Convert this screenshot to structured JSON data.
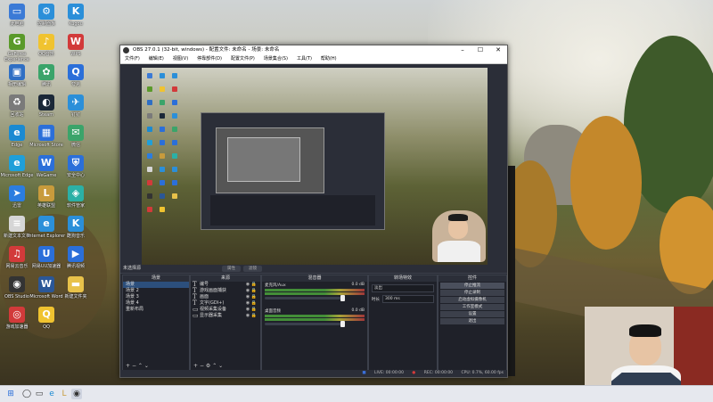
{
  "desktop": {
    "icons": [
      {
        "label": "此电脑",
        "color": "#3b7ad6",
        "glyph": "▭"
      },
      {
        "label": "GeForce Experience",
        "color": "#5a9a2a",
        "glyph": "G"
      },
      {
        "label": "相册编辑",
        "color": "#2f6fc4",
        "glyph": "▣"
      },
      {
        "label": "回收站",
        "color": "#7a7a7a",
        "glyph": "♻"
      },
      {
        "label": "Edge",
        "color": "#1b8ad2",
        "glyph": "e"
      },
      {
        "label": "Microsoft Edge",
        "color": "#1f9fd9",
        "glyph": "e"
      },
      {
        "label": "迅雷",
        "color": "#2b7de0",
        "glyph": "➤"
      },
      {
        "label": "新建文本文档",
        "color": "#d6d6d6",
        "glyph": "≡"
      },
      {
        "label": "网易云音乐",
        "color": "#d23a3a",
        "glyph": "♫"
      },
      {
        "label": "OBS Studio",
        "color": "#333333",
        "glyph": "◉"
      },
      {
        "label": "游戏加速器",
        "color": "#d23a3a",
        "glyph": "◎"
      },
      {
        "label": "控制面板",
        "color": "#2b8fd9",
        "glyph": "⚙"
      },
      {
        "label": "QQ音乐",
        "color": "#f0c330",
        "glyph": "♪"
      },
      {
        "label": "腾讯",
        "color": "#3ba46a",
        "glyph": "✿"
      },
      {
        "label": "Steam",
        "color": "#1b2838",
        "glyph": "◐"
      },
      {
        "label": "Microsoft Store",
        "color": "#2b6fd9",
        "glyph": "▦"
      },
      {
        "label": "WeGame",
        "color": "#2b6fd9",
        "glyph": "W"
      },
      {
        "label": "英雄联盟",
        "color": "#c89b3c",
        "glyph": "L"
      },
      {
        "label": "Internet Explorer",
        "color": "#2b8fd9",
        "glyph": "e"
      },
      {
        "label": "网易UU加速器",
        "color": "#2b6fd9",
        "glyph": "U"
      },
      {
        "label": "Microsoft Word",
        "color": "#2b5797",
        "glyph": "W"
      },
      {
        "label": "QQ",
        "color": "#f0c330",
        "glyph": "Q"
      },
      {
        "label": "Kugou",
        "color": "#2b8fd9",
        "glyph": "K"
      },
      {
        "label": "WPS",
        "color": "#d23a3a",
        "glyph": "W"
      },
      {
        "label": "夸克",
        "color": "#2b6fd9",
        "glyph": "Q"
      },
      {
        "label": "钉钉",
        "color": "#2b8fd9",
        "glyph": "✈"
      },
      {
        "label": "微信",
        "color": "#3ba46a",
        "glyph": "✉"
      },
      {
        "label": "安全中心",
        "color": "#2b6fd9",
        "glyph": "⛨"
      },
      {
        "label": "软件管家",
        "color": "#2bb0a6",
        "glyph": "◈"
      },
      {
        "label": "酷狗音乐",
        "color": "#2b8fd9",
        "glyph": "K"
      },
      {
        "label": "腾讯视频",
        "color": "#2b6fd9",
        "glyph": "▶"
      },
      {
        "label": "新建文件夹",
        "color": "#e8c24a",
        "glyph": "▬"
      }
    ]
  },
  "obs": {
    "title": "OBS 27.0.1 (32-bit, windows) - 配置文件: 未命名 - 场景: 未命名",
    "menu": [
      "文件(F)",
      "编辑(E)",
      "视图(V)",
      "停靠部件(D)",
      "配置文件(P)",
      "场景集合(S)",
      "工具(T)",
      "帮助(H)"
    ],
    "no_source_selected": "未选择源",
    "props_button": "属性",
    "filters_button": "滤镜",
    "scenes": {
      "header": "场景",
      "items": [
        "场景",
        "场景 2",
        "场景 3",
        "场景 4",
        "重新布局"
      ]
    },
    "sources": {
      "header": "来源",
      "items": [
        "编号",
        "游戏画面捕获",
        "画面",
        "文字(GDI+)",
        "视频采集设备",
        "显示器采集"
      ]
    },
    "mixer": {
      "header": "混音器",
      "tracks": [
        {
          "name": "麦克风/Aux",
          "level": "0.0 dB"
        },
        {
          "name": "桌面音频",
          "level": "0.0 dB"
        }
      ]
    },
    "transitions": {
      "header": "转场特效",
      "type": "淡出",
      "duration_label": "时长",
      "duration": "300 ms"
    },
    "controls": {
      "header": "控件",
      "buttons": [
        "停止推流",
        "停止录制",
        "启动虚拟摄像机",
        "工作室模式",
        "设置",
        "退出"
      ]
    },
    "status": {
      "live": "LIVE: 00:00:00",
      "rec": "REC: 00:00:00",
      "cpu": "CPU: 0.7%, 60.00 fps",
      "live_color": "#3a6fd9",
      "rec_color": "#d23a3a"
    }
  },
  "taskbar": {
    "start": "⊞",
    "items": [
      "◯",
      "▭",
      "e",
      "L",
      "◉"
    ]
  }
}
